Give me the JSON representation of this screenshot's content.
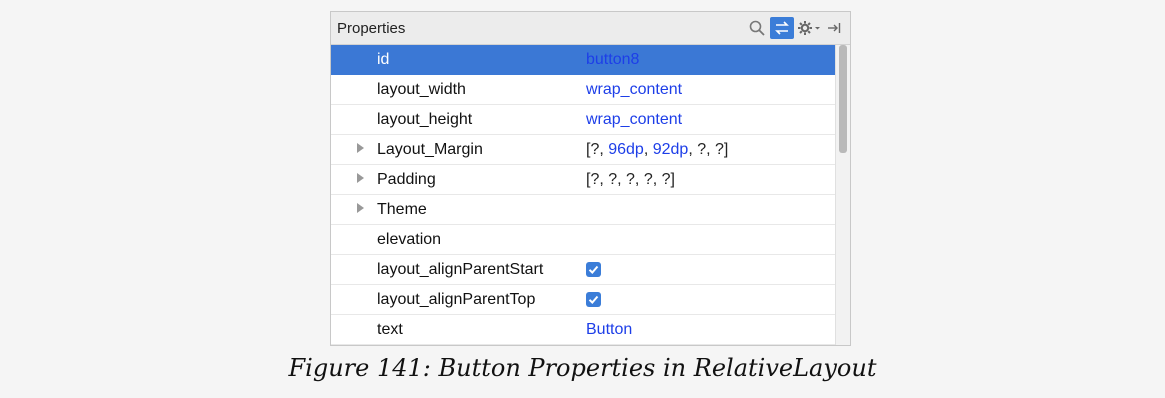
{
  "panel": {
    "title": "Properties",
    "icons": [
      "search-icon",
      "sync-icon",
      "gear-dropdown-icon",
      "pin-to-side-icon"
    ]
  },
  "rows": [
    {
      "name": "id",
      "value": "button8",
      "value_color": "#1d3ee8",
      "expandable": false,
      "selected": true
    },
    {
      "name": "layout_width",
      "value": "wrap_content",
      "value_color": "#1d3ee8",
      "expandable": false
    },
    {
      "name": "layout_height",
      "value": "wrap_content",
      "value_color": "#1d3ee8",
      "expandable": false
    },
    {
      "name": "Layout_Margin",
      "value_parts": [
        "[?, ",
        "96dp",
        ", ",
        "92dp",
        ", ?, ?]"
      ],
      "expandable": true
    },
    {
      "name": "Padding",
      "value": "[?, ?, ?, ?, ?]",
      "expandable": true
    },
    {
      "name": "Theme",
      "value": "",
      "expandable": true
    },
    {
      "name": "elevation",
      "value": "",
      "expandable": false
    },
    {
      "name": "layout_alignParentStart",
      "checked": true,
      "expandable": false
    },
    {
      "name": "layout_alignParentTop",
      "checked": true,
      "expandable": false
    },
    {
      "name": "text",
      "value": "Button",
      "value_color": "#1d3ee8",
      "expandable": false
    }
  ],
  "caption": "Figure 141: Button Properties in RelativeLayout",
  "colors": {
    "selection": "#3b78d5",
    "link": "#1d3ee8"
  }
}
